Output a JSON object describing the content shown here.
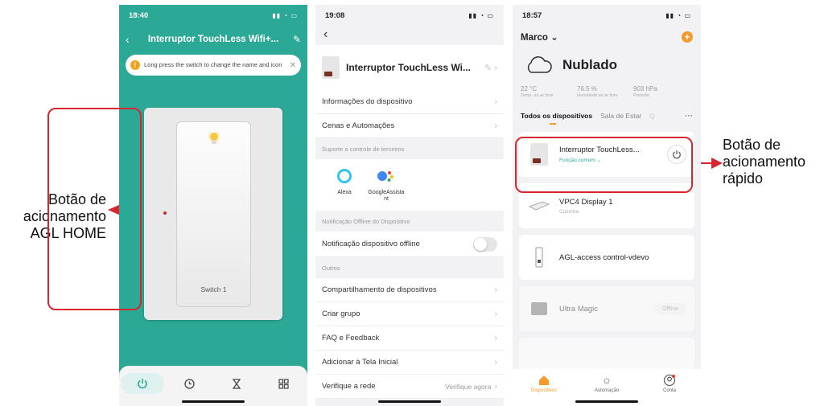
{
  "annotations": {
    "left": [
      "Botão de",
      "acionamento",
      "AGL HOME"
    ],
    "right": [
      "Botão de",
      "acionamento",
      "rápido"
    ]
  },
  "colors": {
    "teal": "#2ba896",
    "red_highlight": "#d8262e",
    "orange": "#f39a2b"
  },
  "screen1": {
    "time": "18:40",
    "title": "Interruptor TouchLess Wifi+...",
    "tip": "Long press the switch to change the name and icon",
    "switch_label": "Switch 1",
    "tabs": [
      {
        "icon": "power-icon",
        "active": true
      },
      {
        "icon": "clock-icon",
        "active": false
      },
      {
        "icon": "hourglass-icon",
        "active": false
      },
      {
        "icon": "grid-icon",
        "active": false
      }
    ]
  },
  "screen2": {
    "time": "19:08",
    "device_name": "Interruptor TouchLess Wi...",
    "row_info": "Informações do dispositivo",
    "row_scenes": "Cenas e Automações",
    "section_third": "Suporte a controle de terceiros",
    "alexa": "Alexa",
    "google": "GoogleAssista nt",
    "section_offline": "Notificação Offline do Dispositivo",
    "row_offline": "Notificação dispositivo offline",
    "section_others": "Outros",
    "row_share": "Compartilhamento de dispositivos",
    "row_group": "Criar grupo",
    "row_faq": "FAQ e Feedback",
    "row_home": "Adicionar à Tela Inicial",
    "row_net": "Verifique a rede",
    "row_net_value": "Verifique agora"
  },
  "screen3": {
    "time": "18:57",
    "user": "Marco",
    "weather": "Nublado",
    "temp_value": "22 °C",
    "temp_label": "Temp. ao ar livre",
    "hum_value": "76.5 %",
    "hum_label": "Humidade ao ar livre",
    "press_value": "903 hPa",
    "press_label": "Pressão",
    "tab_all": "Todos os dispositivos",
    "tab_room": "Sala de Estar",
    "tab_more": "Q",
    "devices": [
      {
        "name": "Interruptor TouchLess...",
        "sub": "Função comum",
        "kind": "switch",
        "dim": false
      },
      {
        "name": "VPC4 Display 1",
        "sub": "Cozinha",
        "kind": "display",
        "dim": false
      },
      {
        "name": "AGL-access control-vdevo",
        "sub": "",
        "kind": "access",
        "dim": false
      },
      {
        "name": "Ultra Magic",
        "sub": "",
        "kind": "magic",
        "dim": true,
        "status": "Offline"
      }
    ],
    "nav_devices": "Dispositivos",
    "nav_auto": "Automação",
    "nav_account": "Conta"
  }
}
